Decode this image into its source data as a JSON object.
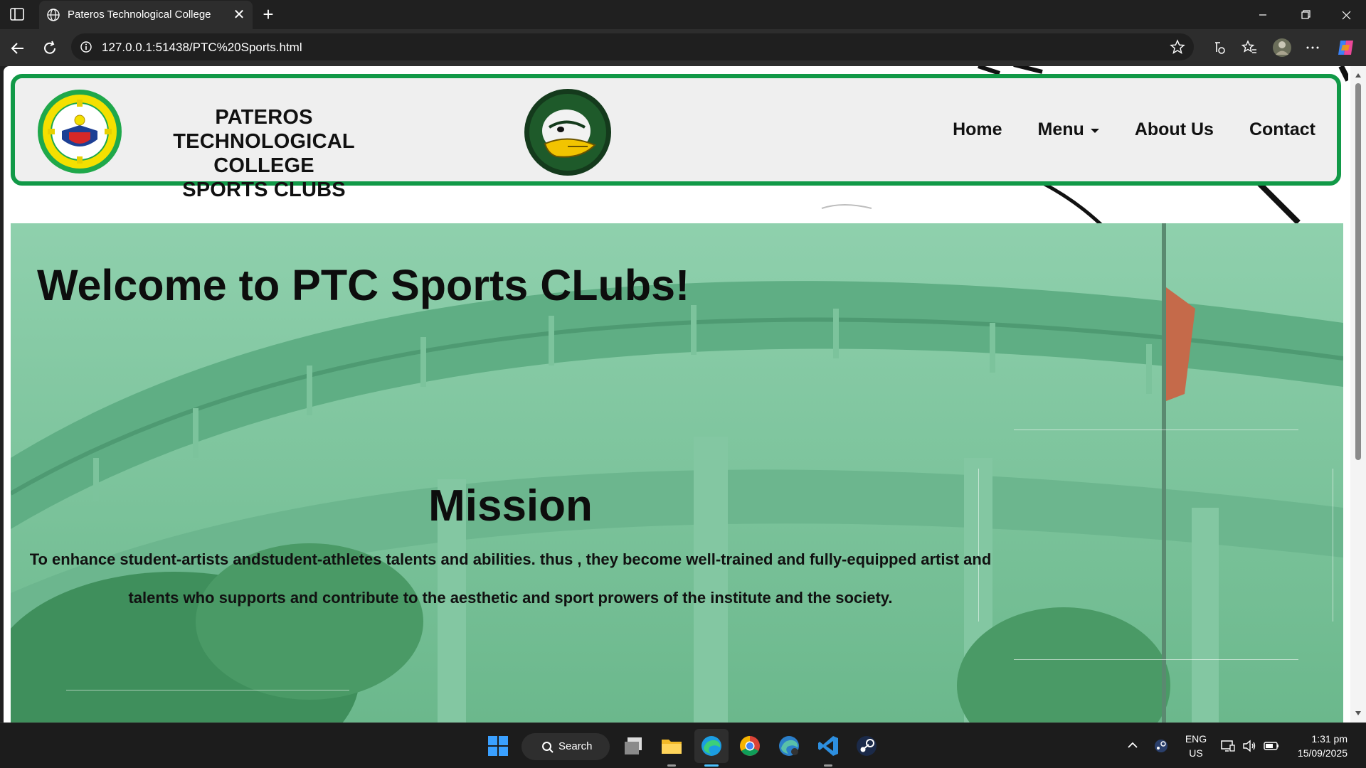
{
  "browser": {
    "tab_title": "Pateros Technological College",
    "url": "127.0.0.1:51438/PTC%20Sports.html"
  },
  "header": {
    "brand_line1": "PATEROS TECHNOLOGICAL COLLEGE",
    "brand_line2": "SPORTS CLUBS",
    "nav": {
      "home": "Home",
      "menu": "Menu",
      "about": "About Us",
      "contact": "Contact"
    }
  },
  "hero": {
    "welcome": "Welcome to PTC Sports CLubs!",
    "mission_title": "Mission",
    "mission_text": "To enhance student-artists andstudent-athletes talents and abilities. thus , they become well-trained and fully-equipped artist and talents who supports and contribute to the aesthetic and sport prowers of the institute and the society."
  },
  "taskbar": {
    "search_label": "Search",
    "language": "ENG",
    "region": "US",
    "time": "1:31 pm",
    "date": "15/09/2025"
  },
  "colors": {
    "header_border": "#119947",
    "hero_tint": "#7ec8a0",
    "chrome_bg": "#202020"
  }
}
